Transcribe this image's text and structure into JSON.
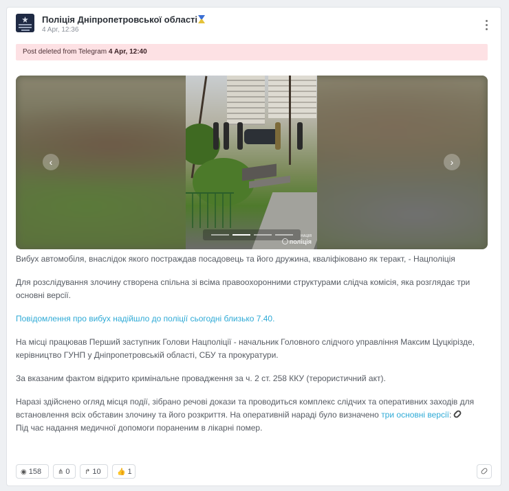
{
  "channel": {
    "name": "Поліція Дніпропетровської області",
    "time": "4 Apr, 12:36"
  },
  "alert": {
    "prefix": "Post deleted from Telegram",
    "date": "4 Apr, 12:40"
  },
  "media": {
    "watermark": "поліція",
    "watermark_small": "НАЦІЯ",
    "prev_symbol": "‹",
    "next_symbol": "›",
    "total_slides": 4,
    "active_slide": 2
  },
  "post": {
    "p1": "Вибух автомобіля, внаслідок якого постраждав посадовець та його дружина, кваліфіковано як теракт, - Нацполіція",
    "p2": "Для розслідування злочину створена спільна зі всіма правоохоронними структурами слідча комісія, яка розглядає три основні версії.",
    "p3_link": "Повідомлення про вибух надійшло до поліції сьогодні близько 7.40.",
    "p4": "На місці працював Перший заступник Голови Нацполіції - начальник Головного слідчого управління Максим Цуцкірізде, керівництво ГУНП у Дніпропетровській області, СБУ та прокуратури.",
    "p5": "За вказаним фактом відкрито кримінальне провадження за ч. 2 ст. 258 ККУ (терористичний акт).",
    "p6_start": "Наразі здійснено огляд місця події, зібрано речові докази та проводиться комплекс слідчих та оперативних заходів для встановлення всіх обставин злочину та його розкриття. На оперативній нараді було визначено ",
    "p6_link": "три основні версії",
    "p6_colon": ":",
    "p7": "Під час надання медичної допомоги пораненим в лікарні помер."
  },
  "stats": {
    "views": "158",
    "shares": "0",
    "forwards": "10",
    "reactions": "1"
  }
}
